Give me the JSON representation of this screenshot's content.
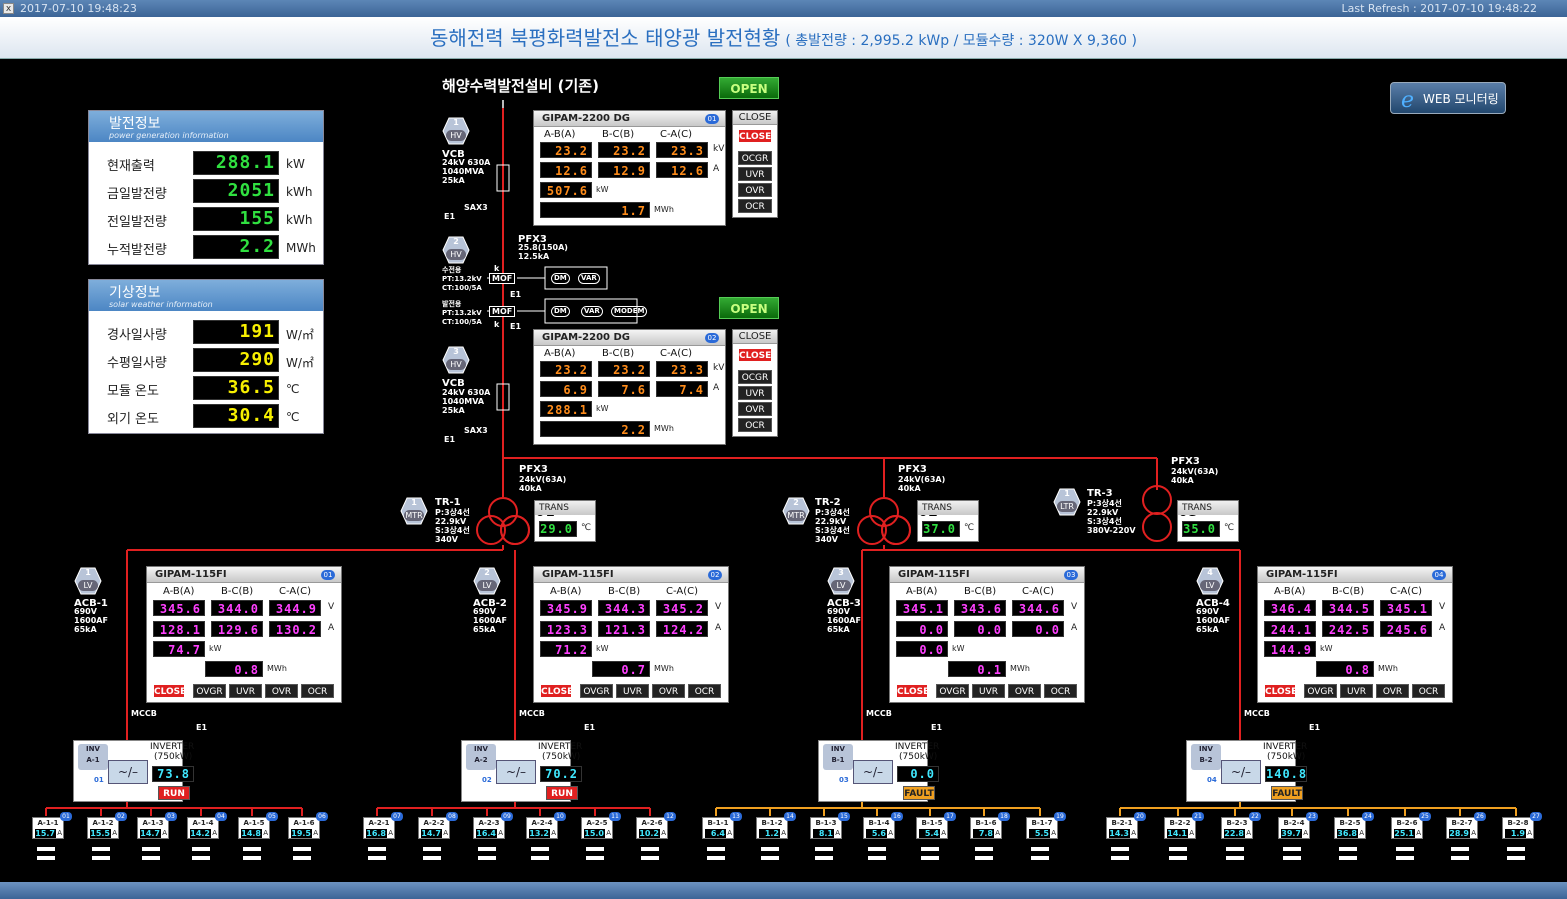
{
  "window": {
    "close": "x",
    "timestamp": "2017-07-10 19:48:23",
    "last_refresh": "Last Refresh : 2017-07-10 19:48:22"
  },
  "header": {
    "title": "동해전력 북평화력발전소 태양광 발전현황",
    "subtitle": "( 총발전량 : 2,995.2 kWp / 모듈수량 : 320W X 9,360 )"
  },
  "web_button": "WEB 모니터링",
  "gen_info": {
    "title": "발전정보",
    "subtitle": "power generation information",
    "rows": [
      {
        "label": "현재출력",
        "value": "288.1",
        "unit": "kW"
      },
      {
        "label": "금일발전량",
        "value": "2051",
        "unit": "kWh"
      },
      {
        "label": "전일발전량",
        "value": "155",
        "unit": "kWh"
      },
      {
        "label": "누적발전량",
        "value": "2.2",
        "unit": "MWh"
      }
    ]
  },
  "weather_info": {
    "title": "기상정보",
    "subtitle": "solar weather information",
    "rows": [
      {
        "label": "경사일사량",
        "value": "191",
        "unit": "W/㎡"
      },
      {
        "label": "수평일사량",
        "value": "290",
        "unit": "W/㎡"
      },
      {
        "label": "모듈 온도",
        "value": "36.5",
        "unit": "℃"
      },
      {
        "label": "외기 온도",
        "value": "30.4",
        "unit": "℃"
      }
    ]
  },
  "existing": "해양수력발전설비 (기존)",
  "status_open": "OPEN",
  "hv1": {
    "no": "1",
    "type": "HV",
    "name": "VCB",
    "spec": "24kV 630A\n1040MVA\n25kA",
    "sax": "SAX3",
    "e1": "E1"
  },
  "hv2": {
    "no": "2",
    "type": "HV",
    "pfx": "PFX3",
    "pfx_spec": "25.8(150A)\n12.5kA"
  },
  "hv3": {
    "no": "3",
    "type": "HV",
    "name": "VCB",
    "spec": "24kV 630A\n1040MVA\n25kA",
    "sax": "SAX3",
    "e1": "E1"
  },
  "mof1": {
    "lbl": "수전용\nPT:13.2kV\nCT:100/5A",
    "mof": "MOF",
    "e1": "E1",
    "k": "k",
    "items": [
      "DM",
      "VAR"
    ]
  },
  "mof2": {
    "lbl": "발전용\nPT:13.2kV\nCT:100/5A",
    "mof": "MOF",
    "e1": "E1",
    "k": "k",
    "items": [
      "DM",
      "VAR",
      "MODEM"
    ]
  },
  "dg_col": [
    "A-B(A)",
    "B-C(B)",
    "C-A(C)"
  ],
  "dg1": {
    "title": "GIPAM-2200 DG",
    "no": "01",
    "kv": [
      "23.2",
      "23.2",
      "23.3"
    ],
    "a": [
      "12.6",
      "12.9",
      "12.6"
    ],
    "kw": "507.6",
    "mwh": "1.7",
    "close_lbl": "CLOSE",
    "close_btn": "CLOSE",
    "relays": [
      "OCGR",
      "UVR",
      "OVR",
      "OCR"
    ]
  },
  "dg2": {
    "title": "GIPAM-2200 DG",
    "no": "02",
    "kv": [
      "23.2",
      "23.2",
      "23.3"
    ],
    "a": [
      "6.9",
      "7.6",
      "7.4"
    ],
    "kw": "288.1",
    "mwh": "2.2",
    "close_lbl": "CLOSE",
    "close_btn": "CLOSE",
    "relays": [
      "OCGR",
      "UVR",
      "OVR",
      "OCR"
    ]
  },
  "units": {
    "kv": "kV",
    "a": "A",
    "kw": "kW",
    "mwh": "MWh",
    "v": "V",
    "c": "℃"
  },
  "pfx": [
    {
      "name": "PFX3",
      "spec": "24kV(63A)\n40kA"
    },
    {
      "name": "PFX3",
      "spec": "24kV(63A)\n40kA"
    },
    {
      "name": "PFX3",
      "spec": "24kV(63A)\n40kA"
    }
  ],
  "tr": [
    {
      "no": "1",
      "type": "MTR",
      "name": "TR-1",
      "spec": "P:3상4선\n22.9kV\nS:3상4선\n340V",
      "trans": "TRANS",
      "tno": "01",
      "temp": "29.0"
    },
    {
      "no": "2",
      "type": "MTR",
      "name": "TR-2",
      "spec": "P:3상4선\n22.9kV\nS:3상4선\n340V",
      "trans": "TRANS",
      "tno": "02",
      "temp": "37.0"
    },
    {
      "no": "1",
      "type": "LTR",
      "name": "TR-3",
      "spec": "P:3상4선\n22.9kV\nS:3상4선\n380V-220V",
      "trans": "TRANS",
      "tno": "03",
      "temp": "35.0"
    }
  ],
  "fi_col": [
    "A-B(A)",
    "B-C(B)",
    "C-A(C)"
  ],
  "lv": [
    {
      "no": "1",
      "type": "LV",
      "acb": "ACB-1",
      "spec": "690V\n1600AF\n65kA",
      "title": "GIPAM-115FI",
      "mno": "01",
      "v": [
        "345.6",
        "344.0",
        "344.9"
      ],
      "a": [
        "128.1",
        "129.6",
        "130.2"
      ],
      "kw": "74.7",
      "mwh": "0.8",
      "close": "CLOSE",
      "relays": [
        "OVGR",
        "UVR",
        "OVR",
        "OCR"
      ],
      "mccb": "MCCB",
      "e1": "E1",
      "inv_id": "INV\nA-1",
      "inv_no": "01",
      "inv_title": "INVERTER",
      "inv_cap": "(750kW)",
      "inv_val": "73.8",
      "inv_state": "RUN"
    },
    {
      "no": "2",
      "type": "LV",
      "acb": "ACB-2",
      "spec": "690V\n1600AF\n65kA",
      "title": "GIPAM-115FI",
      "mno": "02",
      "v": [
        "345.9",
        "344.3",
        "345.2"
      ],
      "a": [
        "123.3",
        "121.3",
        "124.2"
      ],
      "kw": "71.2",
      "mwh": "0.7",
      "close": "CLOSE",
      "relays": [
        "OVGR",
        "UVR",
        "OVR",
        "OCR"
      ],
      "mccb": "MCCB",
      "e1": "E1",
      "inv_id": "INV\nA-2",
      "inv_no": "02",
      "inv_title": "INVERTER",
      "inv_cap": "(750kW)",
      "inv_val": "70.2",
      "inv_state": "RUN"
    },
    {
      "no": "3",
      "type": "LV",
      "acb": "ACB-3",
      "spec": "690V\n1600AF\n65kA",
      "title": "GIPAM-115FI",
      "mno": "03",
      "v": [
        "345.1",
        "343.6",
        "344.6"
      ],
      "a": [
        "0.0",
        "0.0",
        "0.0"
      ],
      "kw": "0.0",
      "mwh": "0.1",
      "close": "CLOSE",
      "relays": [
        "OVGR",
        "UVR",
        "OVR",
        "OCR"
      ],
      "mccb": "MCCB",
      "e1": "E1",
      "inv_id": "INV\nB-1",
      "inv_no": "03",
      "inv_title": "INVERTER",
      "inv_cap": "(750kW)",
      "inv_val": "0.0",
      "inv_state": "FAULT"
    },
    {
      "no": "4",
      "type": "LV",
      "acb": "ACB-4",
      "spec": "690V\n1600AF\n65kA",
      "title": "GIPAM-115FI",
      "mno": "04",
      "v": [
        "346.4",
        "344.5",
        "345.1"
      ],
      "a": [
        "244.1",
        "242.5",
        "245.6"
      ],
      "kw": "144.9",
      "mwh": "0.8",
      "close": "CLOSE",
      "relays": [
        "OVGR",
        "UVR",
        "OVR",
        "OCR"
      ],
      "mccb": "MCCB",
      "e1": "E1",
      "inv_id": "INV\nB-2",
      "inv_no": "04",
      "inv_title": "INVERTER",
      "inv_cap": "(750kW)",
      "inv_val": "140.8",
      "inv_state": "FAULT"
    }
  ],
  "strings": [
    {
      "n": "A-1-1",
      "v": "15.7",
      "b": "01"
    },
    {
      "n": "A-1-2",
      "v": "15.5",
      "b": "02"
    },
    {
      "n": "A-1-3",
      "v": "14.7",
      "b": "03"
    },
    {
      "n": "A-1-4",
      "v": "14.2",
      "b": "04"
    },
    {
      "n": "A-1-5",
      "v": "14.8",
      "b": "05"
    },
    {
      "n": "A-1-6",
      "v": "19.5",
      "b": "06"
    },
    {
      "n": "A-2-1",
      "v": "16.8",
      "b": "07"
    },
    {
      "n": "A-2-2",
      "v": "14.7",
      "b": "08"
    },
    {
      "n": "A-2-3",
      "v": "16.4",
      "b": "09"
    },
    {
      "n": "A-2-4",
      "v": "13.2",
      "b": "10"
    },
    {
      "n": "A-2-5",
      "v": "15.0",
      "b": "11"
    },
    {
      "n": "A-2-6",
      "v": "10.2",
      "b": "12"
    },
    {
      "n": "B-1-1",
      "v": "6.4",
      "b": "13"
    },
    {
      "n": "B-1-2",
      "v": "1.2",
      "b": "14"
    },
    {
      "n": "B-1-3",
      "v": "8.1",
      "b": "15"
    },
    {
      "n": "B-1-4",
      "v": "5.6",
      "b": "16"
    },
    {
      "n": "B-1-5",
      "v": "5.4",
      "b": "17"
    },
    {
      "n": "B-1-6",
      "v": "7.8",
      "b": "18"
    },
    {
      "n": "B-1-7",
      "v": "5.5",
      "b": "19"
    },
    {
      "n": "B-2-1",
      "v": "14.3",
      "b": "20"
    },
    {
      "n": "B-2-2",
      "v": "14.1",
      "b": "21"
    },
    {
      "n": "B-2-3",
      "v": "22.8",
      "b": "22"
    },
    {
      "n": "B-2-4",
      "v": "39.7",
      "b": "23"
    },
    {
      "n": "B-2-5",
      "v": "36.8",
      "b": "24"
    },
    {
      "n": "B-2-6",
      "v": "25.1",
      "b": "25"
    },
    {
      "n": "B-2-7",
      "v": "28.9",
      "b": "26"
    },
    {
      "n": "B-2-8",
      "v": "1.9",
      "b": "27"
    }
  ],
  "colors": {
    "bus": "#e02020",
    "bus_fault": "#f0a020",
    "seg_green": "#30e040",
    "seg_yellow": "#f8f000",
    "seg_orange": "#ff8c1a",
    "seg_magenta": "#ff40ff",
    "seg_cyan": "#40e8ff"
  }
}
